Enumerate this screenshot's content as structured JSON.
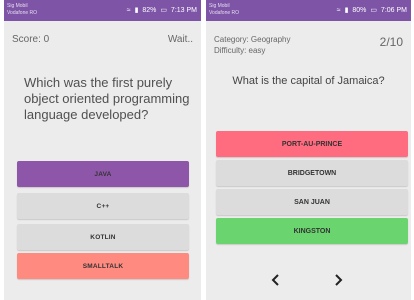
{
  "colors": {
    "status_bar": "#7d54a6",
    "background": "#ececec",
    "selected": "#8e56a8",
    "neutral": "#dcdcdc",
    "wrong": "#ff8a80",
    "incorrect_highlight": "#ff6b7f",
    "correct": "#6ad46f"
  },
  "left_screen": {
    "status": {
      "carrier": "Sig Mobil Vodafone RO",
      "indicators": "82%",
      "time": "7:13 PM"
    },
    "score": "Score: 0",
    "state": "Wait..",
    "question": "Which was the first purely object oriented programming language developed?",
    "answers": [
      {
        "label": "JAVA",
        "state": "selected"
      },
      {
        "label": "C++",
        "state": "neutral"
      },
      {
        "label": "KOTLIN",
        "state": "neutral"
      },
      {
        "label": "SMALLTALK",
        "state": "wrong"
      }
    ]
  },
  "right_screen": {
    "status": {
      "carrier": "Sig Mobil Vodafone RO",
      "indicators": "80%",
      "time": "7:06 PM"
    },
    "category": "Category: Geography",
    "difficulty": "Difficulty: easy",
    "progress": "2/10",
    "question": "What is the capital of Jamaica?",
    "answers": [
      {
        "label": "PORT-AU-PRINCE",
        "state": "incorrect"
      },
      {
        "label": "BRIDGETOWN",
        "state": "neutral"
      },
      {
        "label": "SAN JUAN",
        "state": "neutral"
      },
      {
        "label": "KINGSTON",
        "state": "correct"
      }
    ],
    "nav": {
      "prev_icon": "chevron-left-icon",
      "next_icon": "chevron-right-icon"
    }
  }
}
